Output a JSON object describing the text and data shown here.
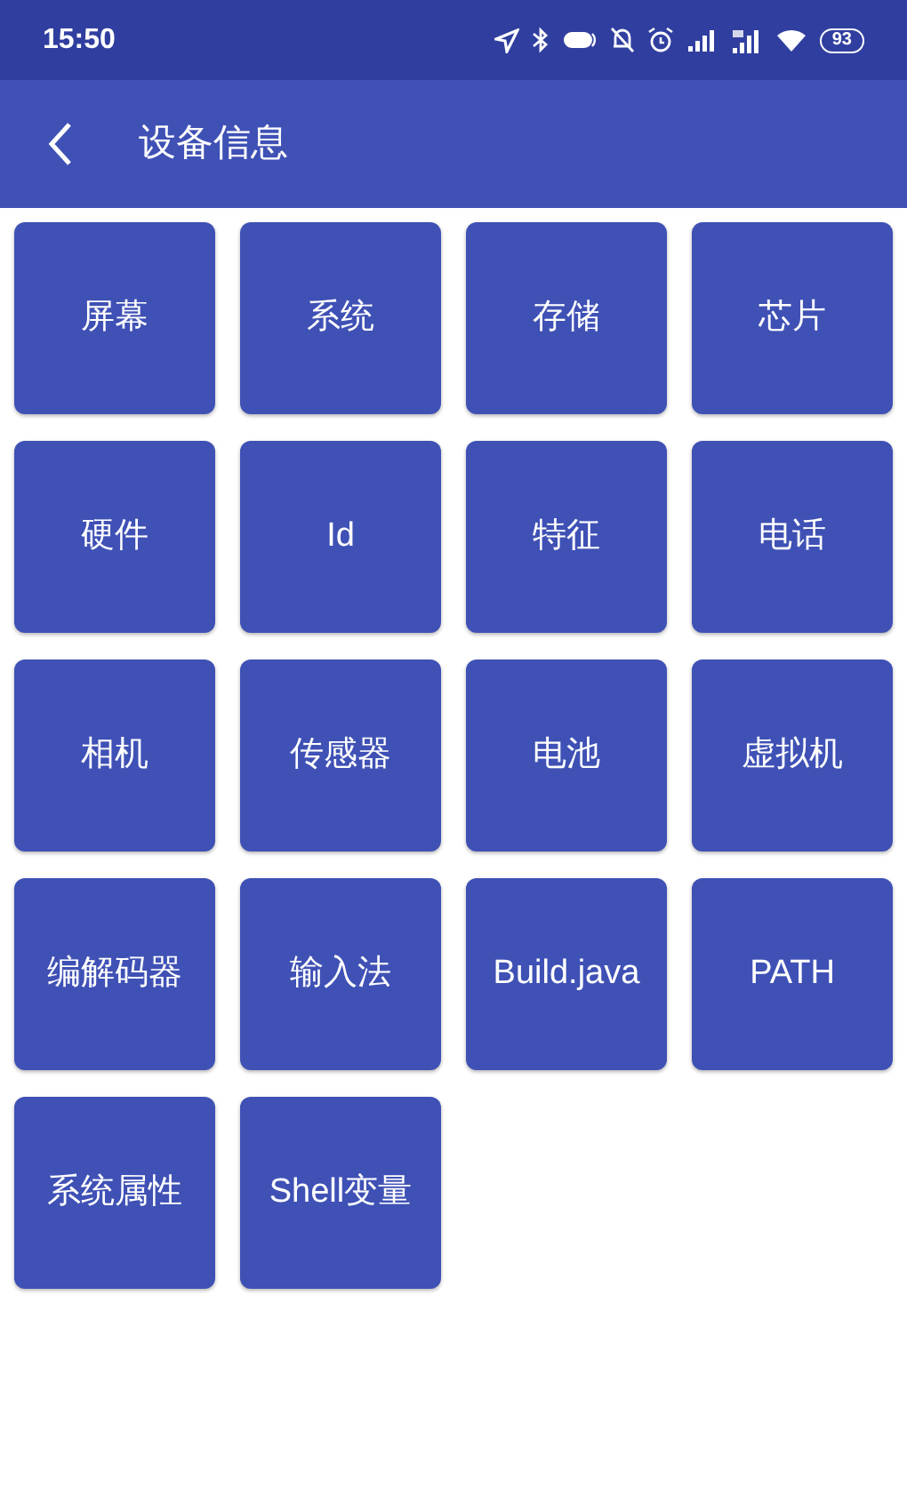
{
  "status_bar": {
    "time": "15:50",
    "battery": "93"
  },
  "app_bar": {
    "title": "设备信息"
  },
  "tiles": [
    {
      "label": "屏幕"
    },
    {
      "label": "系统"
    },
    {
      "label": "存储"
    },
    {
      "label": "芯片"
    },
    {
      "label": "硬件"
    },
    {
      "label": "Id"
    },
    {
      "label": "特征"
    },
    {
      "label": "电话"
    },
    {
      "label": "相机"
    },
    {
      "label": "传感器"
    },
    {
      "label": "电池"
    },
    {
      "label": "虚拟机"
    },
    {
      "label": "编解码器"
    },
    {
      "label": "输入法"
    },
    {
      "label": "Build.java"
    },
    {
      "label": "PATH"
    },
    {
      "label": "系统属性"
    },
    {
      "label": "Shell变量"
    }
  ]
}
